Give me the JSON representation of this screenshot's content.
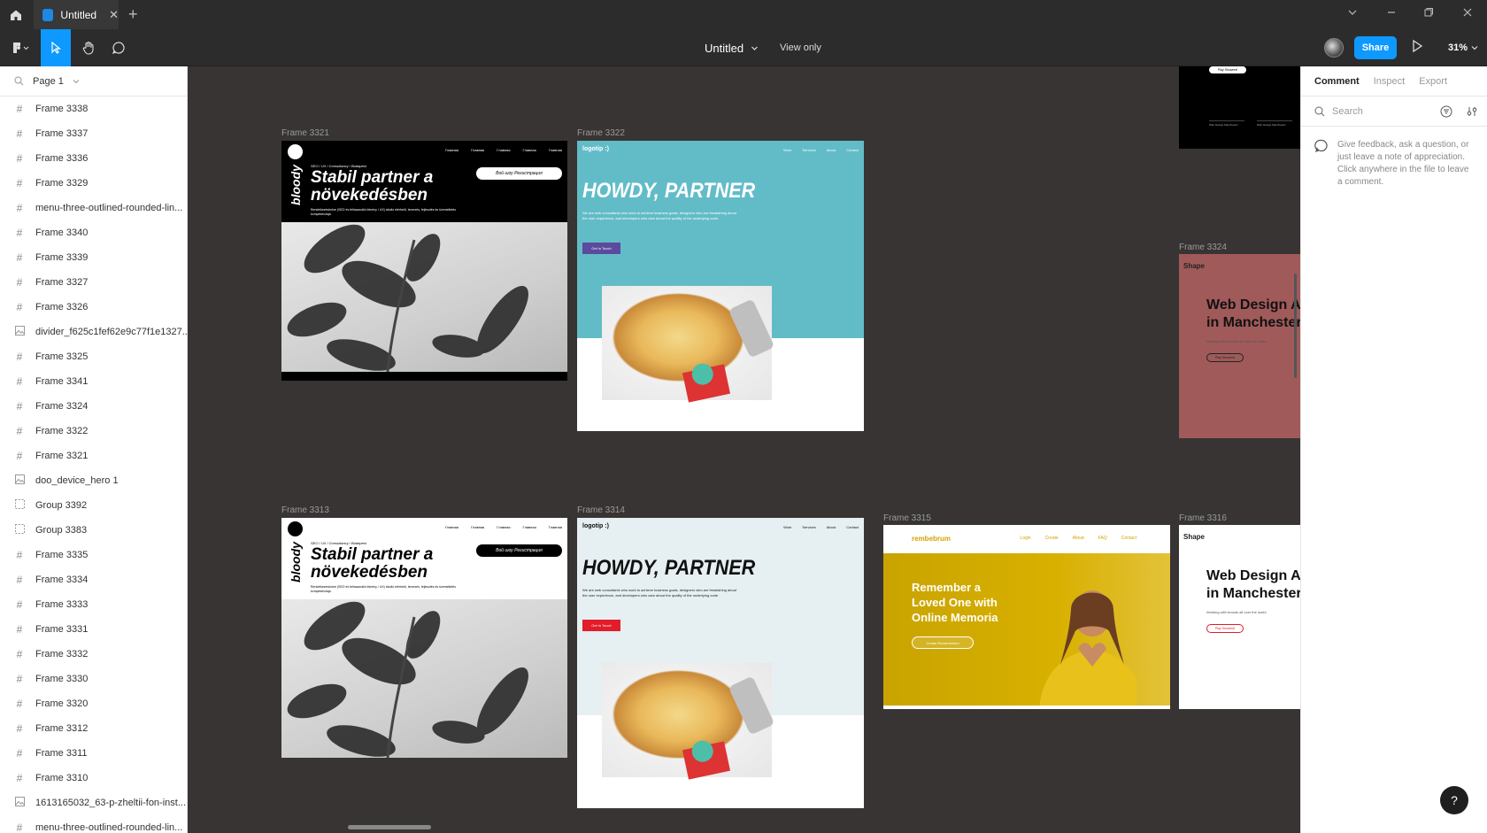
{
  "window": {
    "tab_title": "Untitled",
    "close": "✕",
    "new_tab": "+"
  },
  "toolbar": {
    "file_title": "Untitled",
    "view_only": "View only",
    "share": "Share",
    "zoom": "31%"
  },
  "left_panel": {
    "page": "Page 1",
    "layers": [
      {
        "icon": "frame",
        "label": "Frame 3338"
      },
      {
        "icon": "frame",
        "label": "Frame 3337"
      },
      {
        "icon": "frame",
        "label": "Frame 3336"
      },
      {
        "icon": "frame",
        "label": "Frame 3329"
      },
      {
        "icon": "frame",
        "label": "menu-three-outlined-rounded-lin..."
      },
      {
        "icon": "frame",
        "label": "Frame 3340"
      },
      {
        "icon": "frame",
        "label": "Frame 3339"
      },
      {
        "icon": "frame",
        "label": "Frame 3327"
      },
      {
        "icon": "frame",
        "label": "Frame 3326"
      },
      {
        "icon": "image",
        "label": "divider_f625c1fef62e9c77f1e1327..."
      },
      {
        "icon": "frame",
        "label": "Frame 3325"
      },
      {
        "icon": "frame",
        "label": "Frame 3341"
      },
      {
        "icon": "frame",
        "label": "Frame 3324"
      },
      {
        "icon": "frame",
        "label": "Frame 3322"
      },
      {
        "icon": "frame",
        "label": "Frame 3321"
      },
      {
        "icon": "image",
        "label": "doo_device_hero 1"
      },
      {
        "icon": "group",
        "label": "Group 3392"
      },
      {
        "icon": "group",
        "label": "Group 3383"
      },
      {
        "icon": "frame",
        "label": "Frame 3335"
      },
      {
        "icon": "frame",
        "label": "Frame 3334"
      },
      {
        "icon": "frame",
        "label": "Frame 3333"
      },
      {
        "icon": "frame",
        "label": "Frame 3331"
      },
      {
        "icon": "frame",
        "label": "Frame 3332"
      },
      {
        "icon": "frame",
        "label": "Frame 3330"
      },
      {
        "icon": "frame",
        "label": "Frame 3320"
      },
      {
        "icon": "frame",
        "label": "Frame 3312"
      },
      {
        "icon": "frame",
        "label": "Frame 3311"
      },
      {
        "icon": "frame",
        "label": "Frame 3310"
      },
      {
        "icon": "image",
        "label": "1613165032_63-p-zheltii-fon-inst..."
      },
      {
        "icon": "frame",
        "label": "menu-three-outlined-rounded-lin..."
      }
    ]
  },
  "canvas": {
    "frames": {
      "f3321": {
        "label": "Frame 3321"
      },
      "f3322": {
        "label": "Frame 3322"
      },
      "f3313": {
        "label": "Frame 3313"
      },
      "f3314": {
        "label": "Frame 3314"
      },
      "f3315": {
        "label": "Frame 3315"
      },
      "f3316": {
        "label": "Frame 3316"
      },
      "f3324": {
        "label": "Frame 3324"
      }
    },
    "plant": {
      "brand": "bloody",
      "nav": [
        "Главная",
        "Главная",
        "Главная",
        "Главная",
        "Главная"
      ],
      "small": "SEO / UX / Consultancy / Budapest",
      "title_line1": "Stabil partner a",
      "title_line2": "növekedésben",
      "desc": "Rendelkezésünkre (SEO és felhasználói élmény / UX) stúdió elérhető, tervezés, fejlesztés és üzemeltetés kompetenciája.",
      "button": "Вой шоу Регистрация"
    },
    "howdy": {
      "logo": "logotip :)",
      "nav": [
        "Work",
        "Services",
        "About",
        "Contact"
      ],
      "title": "HOWDY, PARTNER",
      "text": "We are web consultants who work to achieve business goals, designers who are freakishing about the user experience, and developers who care about the quality of the underlying code.",
      "button": "Get in Touch"
    },
    "memoria": {
      "logo": "rembebrum",
      "nav": [
        "Login",
        "Create",
        "About",
        "FAQ",
        "Contact"
      ],
      "title_line1": "Remember a",
      "title_line2": "Loved One with",
      "title_line3": "Online Memoria",
      "button": "Create Remembrium"
    },
    "shape": {
      "logo": "Shape",
      "title_line1": "Web Design A",
      "title_line2": "in Manchester",
      "sub": "Working with brands all over the world",
      "button": "Play Showreel"
    },
    "top_frame": {
      "button": "Play Showreel",
      "links": [
        "Web Design Manchester",
        "Web Design Manchester"
      ]
    }
  },
  "right_panel": {
    "tabs": [
      "Comment",
      "Inspect",
      "Export"
    ],
    "search_placeholder": "Search",
    "feedback": "Give feedback, ask a question, or just leave a note of appreciation. Click anywhere in the file to leave a comment.",
    "help": "?"
  },
  "colors": {
    "accent": "#0d99ff",
    "howdy_teal": "#62bcc8",
    "howdy_light": "#e6eff1",
    "memoria_yellow": "#d4a300",
    "shape_rose": "#a05a5a",
    "howdy_button_purple": "#5b4a9e",
    "howdy_button_red": "#e11d2a"
  }
}
